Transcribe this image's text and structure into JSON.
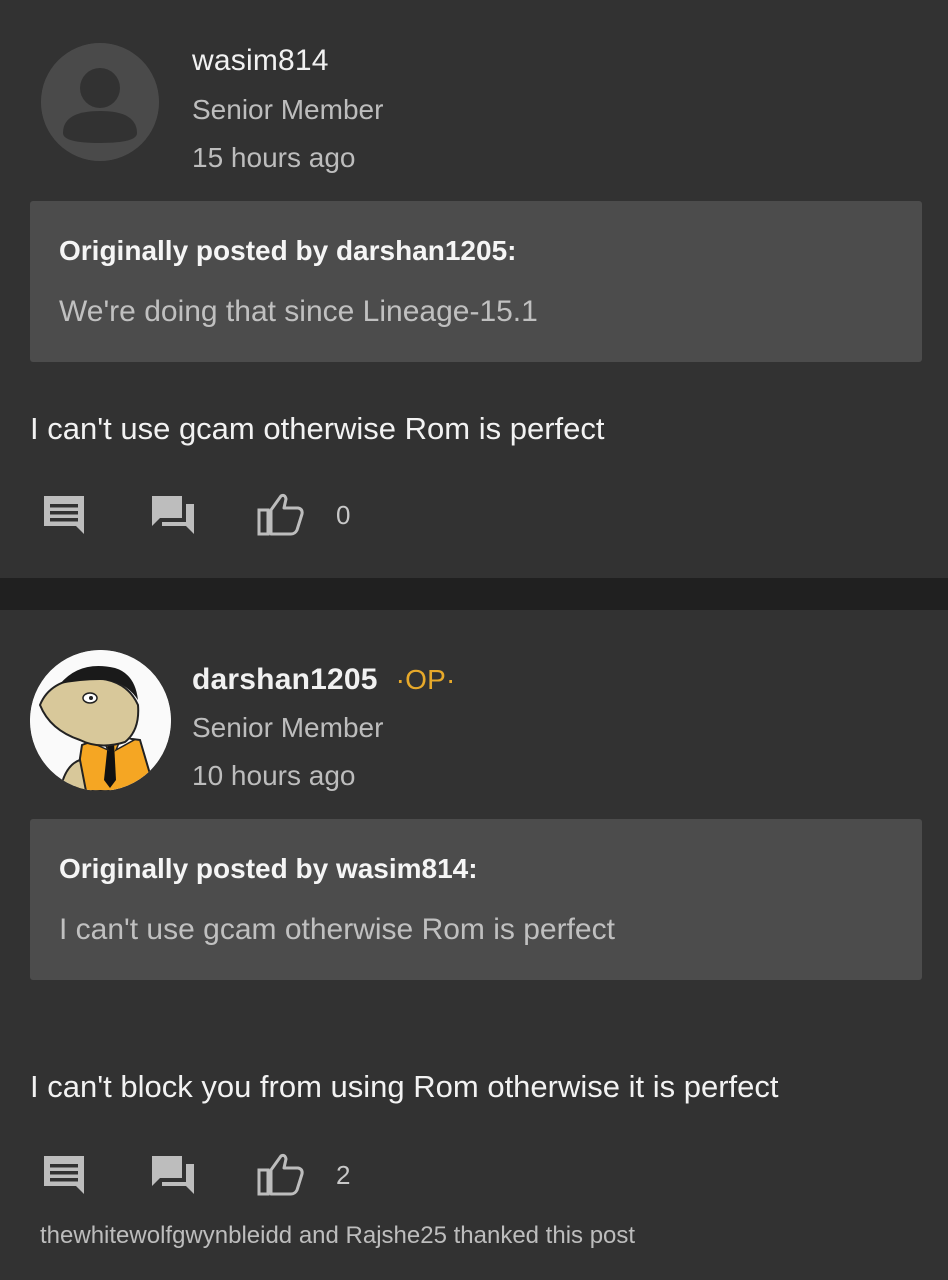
{
  "posts": [
    {
      "username": "wasim814",
      "role": "Senior Member",
      "time": "15 hours ago",
      "quote": {
        "author": "Originally posted by darshan1205:",
        "text": "We're doing that since Lineage-15.1"
      },
      "body": "I can't use gcam otherwise Rom is perfect",
      "likes": "0",
      "avatar": "default-user-icon"
    },
    {
      "username": "darshan1205",
      "badge": "·OP·",
      "role": "Senior Member",
      "time": "10 hours ago",
      "quote": {
        "author": "Originally posted by wasim814:",
        "text": "I can't use gcam otherwise Rom is perfect"
      },
      "body": "I can't block you from using Rom otherwise it is perfect",
      "likes": "2",
      "thanks": "thewhitewolfgwynbleidd and Rajshe25 thanked this post",
      "avatar": "cartoon-avatar"
    }
  ],
  "colors": {
    "background": "#323232",
    "separator": "#202020",
    "quote_bg": "#4c4c4c",
    "op_badge": "#e7a92a"
  }
}
